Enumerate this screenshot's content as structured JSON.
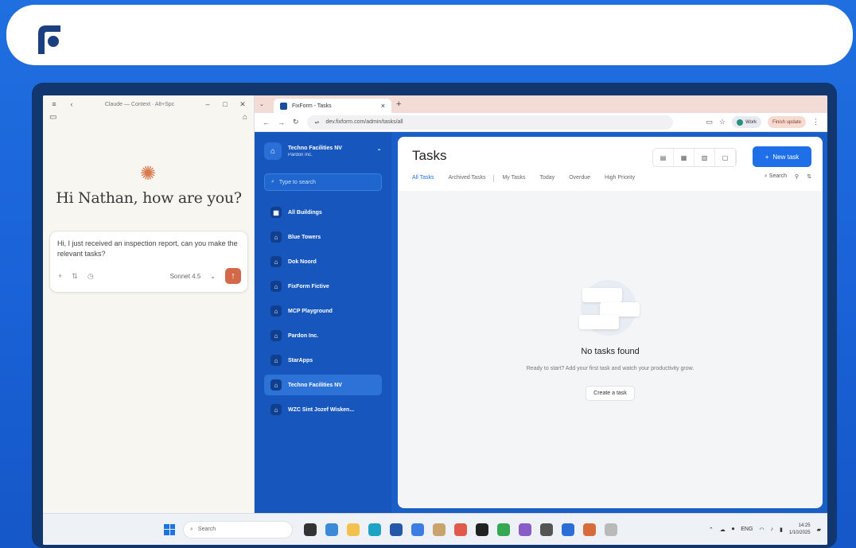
{
  "claude": {
    "window_title": "Claude — Context · Alt+Spc",
    "greeting": "Hi Nathan, how are you?",
    "prompt_text": "Hi, I just received an inspection report, can you make the relevant tasks?",
    "model": "Sonnet 4.5",
    "accent": "#d4694a"
  },
  "browser": {
    "tab_title": "FixForm - Tasks",
    "url": "dev.fixform.com/admin/tasks/all",
    "profile_label": "Work",
    "finish_update_label": "Finish update"
  },
  "sidebar": {
    "org_name": "Techno Facilities NV",
    "org_sub": "Pardon Inc.",
    "search_placeholder": "Type to search",
    "items": [
      {
        "label": "All Buildings"
      },
      {
        "label": "Blue Towers"
      },
      {
        "label": "Dok Noord"
      },
      {
        "label": "FixForm Fictive"
      },
      {
        "label": "MCP Playground"
      },
      {
        "label": "Pardon Inc."
      },
      {
        "label": "StarApps"
      },
      {
        "label": "Techno Facilities NV"
      },
      {
        "label": "WZC Sint Jozef Wisken..."
      }
    ]
  },
  "main": {
    "title": "Tasks",
    "new_task_label": "New task",
    "tabs": [
      "All Tasks",
      "Archived Tasks",
      "My Tasks",
      "Today",
      "Overdue",
      "High Priority"
    ],
    "search_label": "Search",
    "empty_title": "No tasks found",
    "empty_desc": "Ready to start? Add your first task and watch your productivity grow.",
    "create_label": "Create a task"
  },
  "taskbar": {
    "search_placeholder": "Search",
    "lang": "ENG",
    "time": "14:25",
    "date": "1/10/2025"
  }
}
